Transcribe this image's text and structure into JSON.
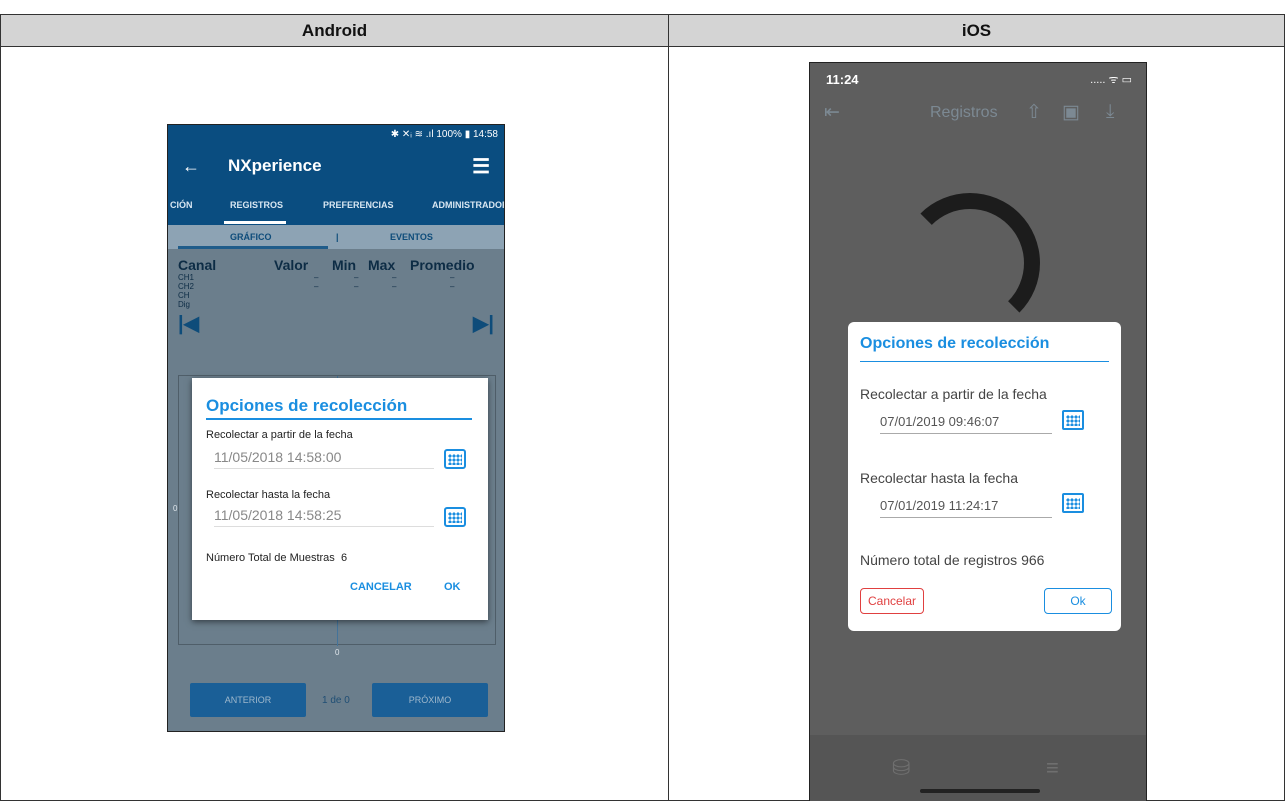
{
  "headers": {
    "android": "Android",
    "ios": "iOS"
  },
  "android": {
    "status_bar": "✱ ✕ᵢ ≋ .ıl 100% ▮ 14:58",
    "app_title": "NXperience",
    "back_icon": "arrow-left-icon",
    "menu_icon": "hamburger-menu-icon",
    "tabs": [
      {
        "label": "CIÓN"
      },
      {
        "label": "REGISTROS"
      },
      {
        "label": "PREFERENCIAS"
      },
      {
        "label": "ADMINISTRADOR"
      }
    ],
    "subtabs": [
      {
        "label": "GRÁFICO"
      },
      {
        "label": "EVENTOS"
      }
    ],
    "channels": {
      "header": [
        "Canal",
        "Valor",
        "Min",
        "Max",
        "Promedio"
      ],
      "rows": [
        {
          "name": "CH1",
          "values": [
            "–",
            "–",
            "–",
            "–"
          ]
        },
        {
          "name": "CH2",
          "values": [
            "–",
            "–",
            "–",
            "–"
          ]
        },
        {
          "name": "CH",
          "values": []
        },
        {
          "name": "Dig",
          "values": []
        }
      ]
    },
    "chart_axis": {
      "y0": "0",
      "x0": "0"
    },
    "prev_button": "ANTERIOR",
    "next_button": "PRÓXIMO",
    "pager": "1 de 0",
    "dialog": {
      "title": "Opciones de recolección",
      "from_label": "Recolectar a partir de la fecha",
      "from_value": "11/05/2018 14:58:00",
      "to_label": "Recolectar hasta la fecha",
      "to_value": "11/05/2018 14:58:25",
      "total_label": "Número Total de Muestras",
      "total_value": "6",
      "cancel": "CANCELAR",
      "ok": "OK"
    }
  },
  "ios": {
    "time": "11:24",
    "status_right": "..... ᯤ ▭",
    "nav_title": "Registros",
    "dialog": {
      "title": "Opciones de recolección",
      "from_label": "Recolectar a partir de la fecha",
      "from_value": "07/01/2019 09:46:07",
      "to_label": "Recolectar hasta la fecha",
      "to_value": "07/01/2019 11:24:17",
      "total_label": "Número total de registros",
      "total_value": "966",
      "cancel": "Cancelar",
      "ok": "Ok"
    }
  }
}
